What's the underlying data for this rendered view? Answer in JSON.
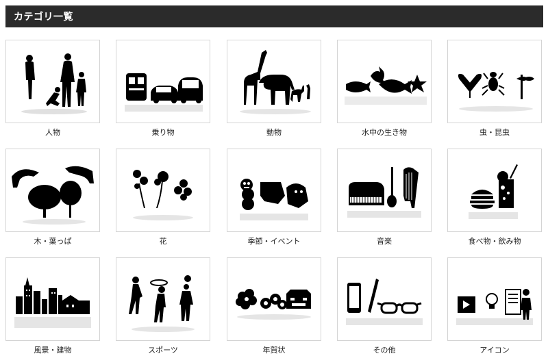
{
  "header": {
    "title": "カテゴリ一覧"
  },
  "categories": [
    {
      "label": "人物",
      "icon": "people-silhouette-icon"
    },
    {
      "label": "乗り物",
      "icon": "vehicles-silhouette-icon"
    },
    {
      "label": "動物",
      "icon": "animals-silhouette-icon"
    },
    {
      "label": "水中の生き物",
      "icon": "sea-creatures-silhouette-icon"
    },
    {
      "label": "虫・昆虫",
      "icon": "insects-silhouette-icon"
    },
    {
      "label": "木・葉っぱ",
      "icon": "trees-leaves-silhouette-icon"
    },
    {
      "label": "花",
      "icon": "flowers-silhouette-icon"
    },
    {
      "label": "季節・イベント",
      "icon": "season-events-silhouette-icon"
    },
    {
      "label": "音楽",
      "icon": "music-instruments-silhouette-icon"
    },
    {
      "label": "食べ物・飲み物",
      "icon": "food-drink-silhouette-icon"
    },
    {
      "label": "風景・建物",
      "icon": "cityscape-silhouette-icon"
    },
    {
      "label": "スポーツ",
      "icon": "sports-silhouette-icon"
    },
    {
      "label": "年賀状",
      "icon": "new-year-card-silhouette-icon"
    },
    {
      "label": "その他",
      "icon": "misc-items-silhouette-icon"
    },
    {
      "label": "アイコン",
      "icon": "icon-set-silhouette-icon"
    }
  ],
  "colors": {
    "header_bg": "#2b2b2b",
    "silhouette": "#000000",
    "border": "#d4d4d4"
  }
}
